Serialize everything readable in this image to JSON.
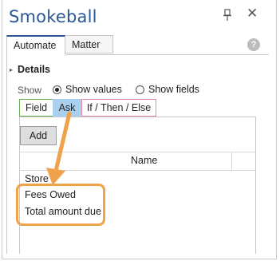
{
  "window": {
    "title": "Smokeball",
    "close_glyph": "✕"
  },
  "top_tabs": {
    "automate": "Automate",
    "matter": "Matter"
  },
  "help_glyph": "?",
  "details": {
    "label": "Details",
    "triangle": "▸"
  },
  "show": {
    "label": "Show",
    "options": [
      {
        "label": "Show values",
        "selected": true
      },
      {
        "label": "Show fields",
        "selected": false
      }
    ]
  },
  "field_tabs": {
    "field": "Field",
    "ask": "Ask",
    "ifthen": "If / Then / Else",
    "active": "Ask"
  },
  "add_button": "Add",
  "grid": {
    "column_header": "Name",
    "rows": [
      "Store",
      "Fees Owed",
      "Total amount due"
    ],
    "highlighted_rows": [
      "Fees Owed",
      "Total amount due"
    ]
  },
  "colors": {
    "title": "#2b5797",
    "annotation": "#f0a24a",
    "ask_tab": "#a9d0ee",
    "field_tab_border": "#6ab04c",
    "ifthen_tab_border": "#e58ca0"
  },
  "icons": [
    "pin-icon",
    "close-icon",
    "help-icon",
    "expand-triangle-icon",
    "annotation-arrow"
  ]
}
